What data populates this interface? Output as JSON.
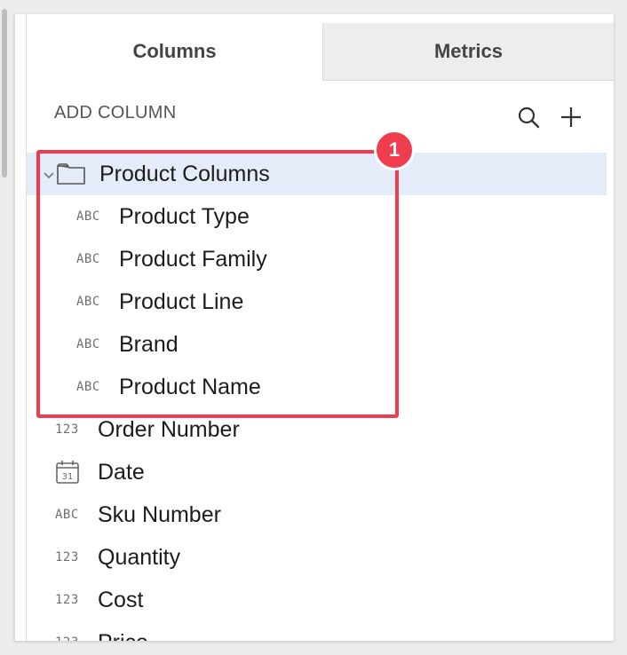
{
  "tabs": [
    {
      "label": "Columns",
      "active": true
    },
    {
      "label": "Metrics",
      "active": false
    }
  ],
  "header": {
    "title": "ADD COLUMN",
    "search_icon": "search-icon",
    "add_icon": "plus-icon"
  },
  "group": {
    "label": "Product Columns",
    "expanded": true,
    "items": [
      {
        "type": "ABC",
        "label": "Product Type"
      },
      {
        "type": "ABC",
        "label": "Product Family"
      },
      {
        "type": "ABC",
        "label": "Product Line"
      },
      {
        "type": "ABC",
        "label": "Brand"
      },
      {
        "type": "ABC",
        "label": "Product Name"
      }
    ]
  },
  "columns": [
    {
      "type": "123",
      "label": "Order Number"
    },
    {
      "type": "calendar-icon",
      "label": "Date"
    },
    {
      "type": "ABC",
      "label": "Sku Number"
    },
    {
      "type": "123",
      "label": "Quantity"
    },
    {
      "type": "123",
      "label": "Cost"
    },
    {
      "type": "123",
      "label": "Price"
    }
  ],
  "annotation": {
    "number": "1",
    "color": "#ef3d4f"
  },
  "colors": {
    "selected_row": "#e5ecf9",
    "inactive_tab": "#ededed"
  }
}
